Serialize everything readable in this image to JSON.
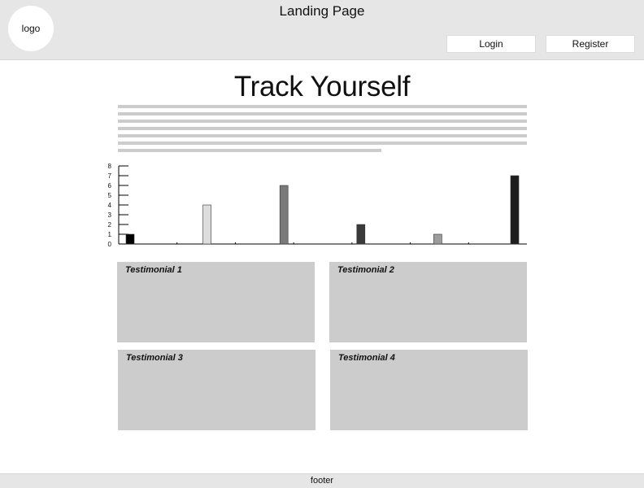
{
  "header": {
    "logo_text": "logo",
    "page_label": "Landing Page",
    "login_label": "Login",
    "register_label": "Register"
  },
  "hero": {
    "title": "Track Yourself"
  },
  "chart_data": {
    "type": "bar",
    "title": "",
    "xlabel": "",
    "ylabel": "",
    "ylim": [
      0,
      8
    ],
    "yticks": [
      0,
      1,
      2,
      3,
      4,
      5,
      6,
      7,
      8
    ],
    "categories": [
      "",
      "",
      "",
      "",
      "",
      "",
      ""
    ],
    "values": [
      1,
      4,
      6,
      2,
      1,
      7
    ],
    "bar_colors": [
      "#000000",
      "#dddddd",
      "#7a7a7a",
      "#3a3a3a",
      "#9c9c9c",
      "#1e1e1e"
    ],
    "grid": false
  },
  "testimonials": [
    {
      "label": "Testimonial 1"
    },
    {
      "label": "Testimonial 2"
    },
    {
      "label": "Testimonial 3"
    },
    {
      "label": "Testimonial 4"
    }
  ],
  "footer": {
    "label": "footer"
  }
}
